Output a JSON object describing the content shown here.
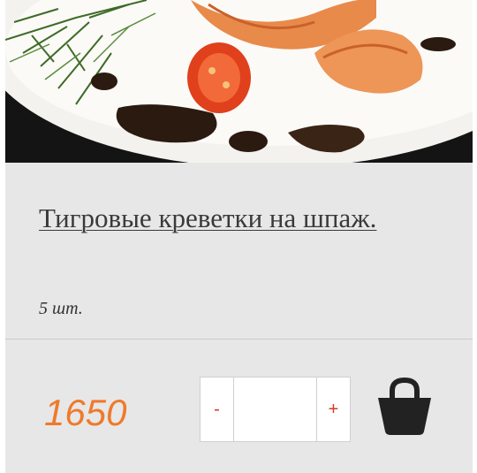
{
  "product": {
    "name": "Тигровые креветки на шпаж.",
    "portion": "5 шт.",
    "price": "1650"
  },
  "quantity": {
    "minus_label": "-",
    "plus_label": "+",
    "value": ""
  },
  "icons": {
    "cart": "shopping-basket-icon"
  },
  "colors": {
    "price": "#ef7a2b",
    "stepper_symbols": "#d33a24",
    "card_background": "#e7e7e7",
    "title": "#3a3a3a"
  }
}
